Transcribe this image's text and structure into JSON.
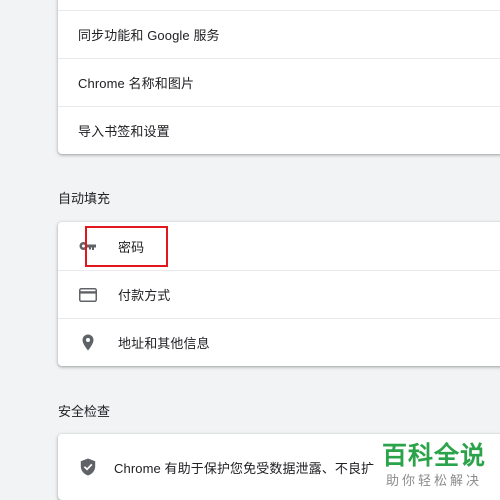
{
  "top_card": {
    "items": [
      {
        "label": "同步功能和 Google 服务"
      },
      {
        "label": "Chrome 名称和图片"
      },
      {
        "label": "导入书签和设置"
      }
    ]
  },
  "autofill": {
    "section_title": "自动填充",
    "items": [
      {
        "label": "密码",
        "icon": "key-icon"
      },
      {
        "label": "付款方式",
        "icon": "credit-card-icon"
      },
      {
        "label": "地址和其他信息",
        "icon": "location-pin-icon"
      }
    ]
  },
  "safety": {
    "section_title": "安全检查",
    "item": {
      "label": "Chrome 有助于保护您免受数据泄露、不良扩",
      "icon": "shield-check-icon"
    }
  },
  "watermark": {
    "brand": "百科全说",
    "sub": "助你轻松解决"
  },
  "colors": {
    "background": "#f1f3f4",
    "card": "#ffffff",
    "icon": "#5f6368",
    "highlight": "#e2171e",
    "watermark_green": "#2ba34a"
  }
}
